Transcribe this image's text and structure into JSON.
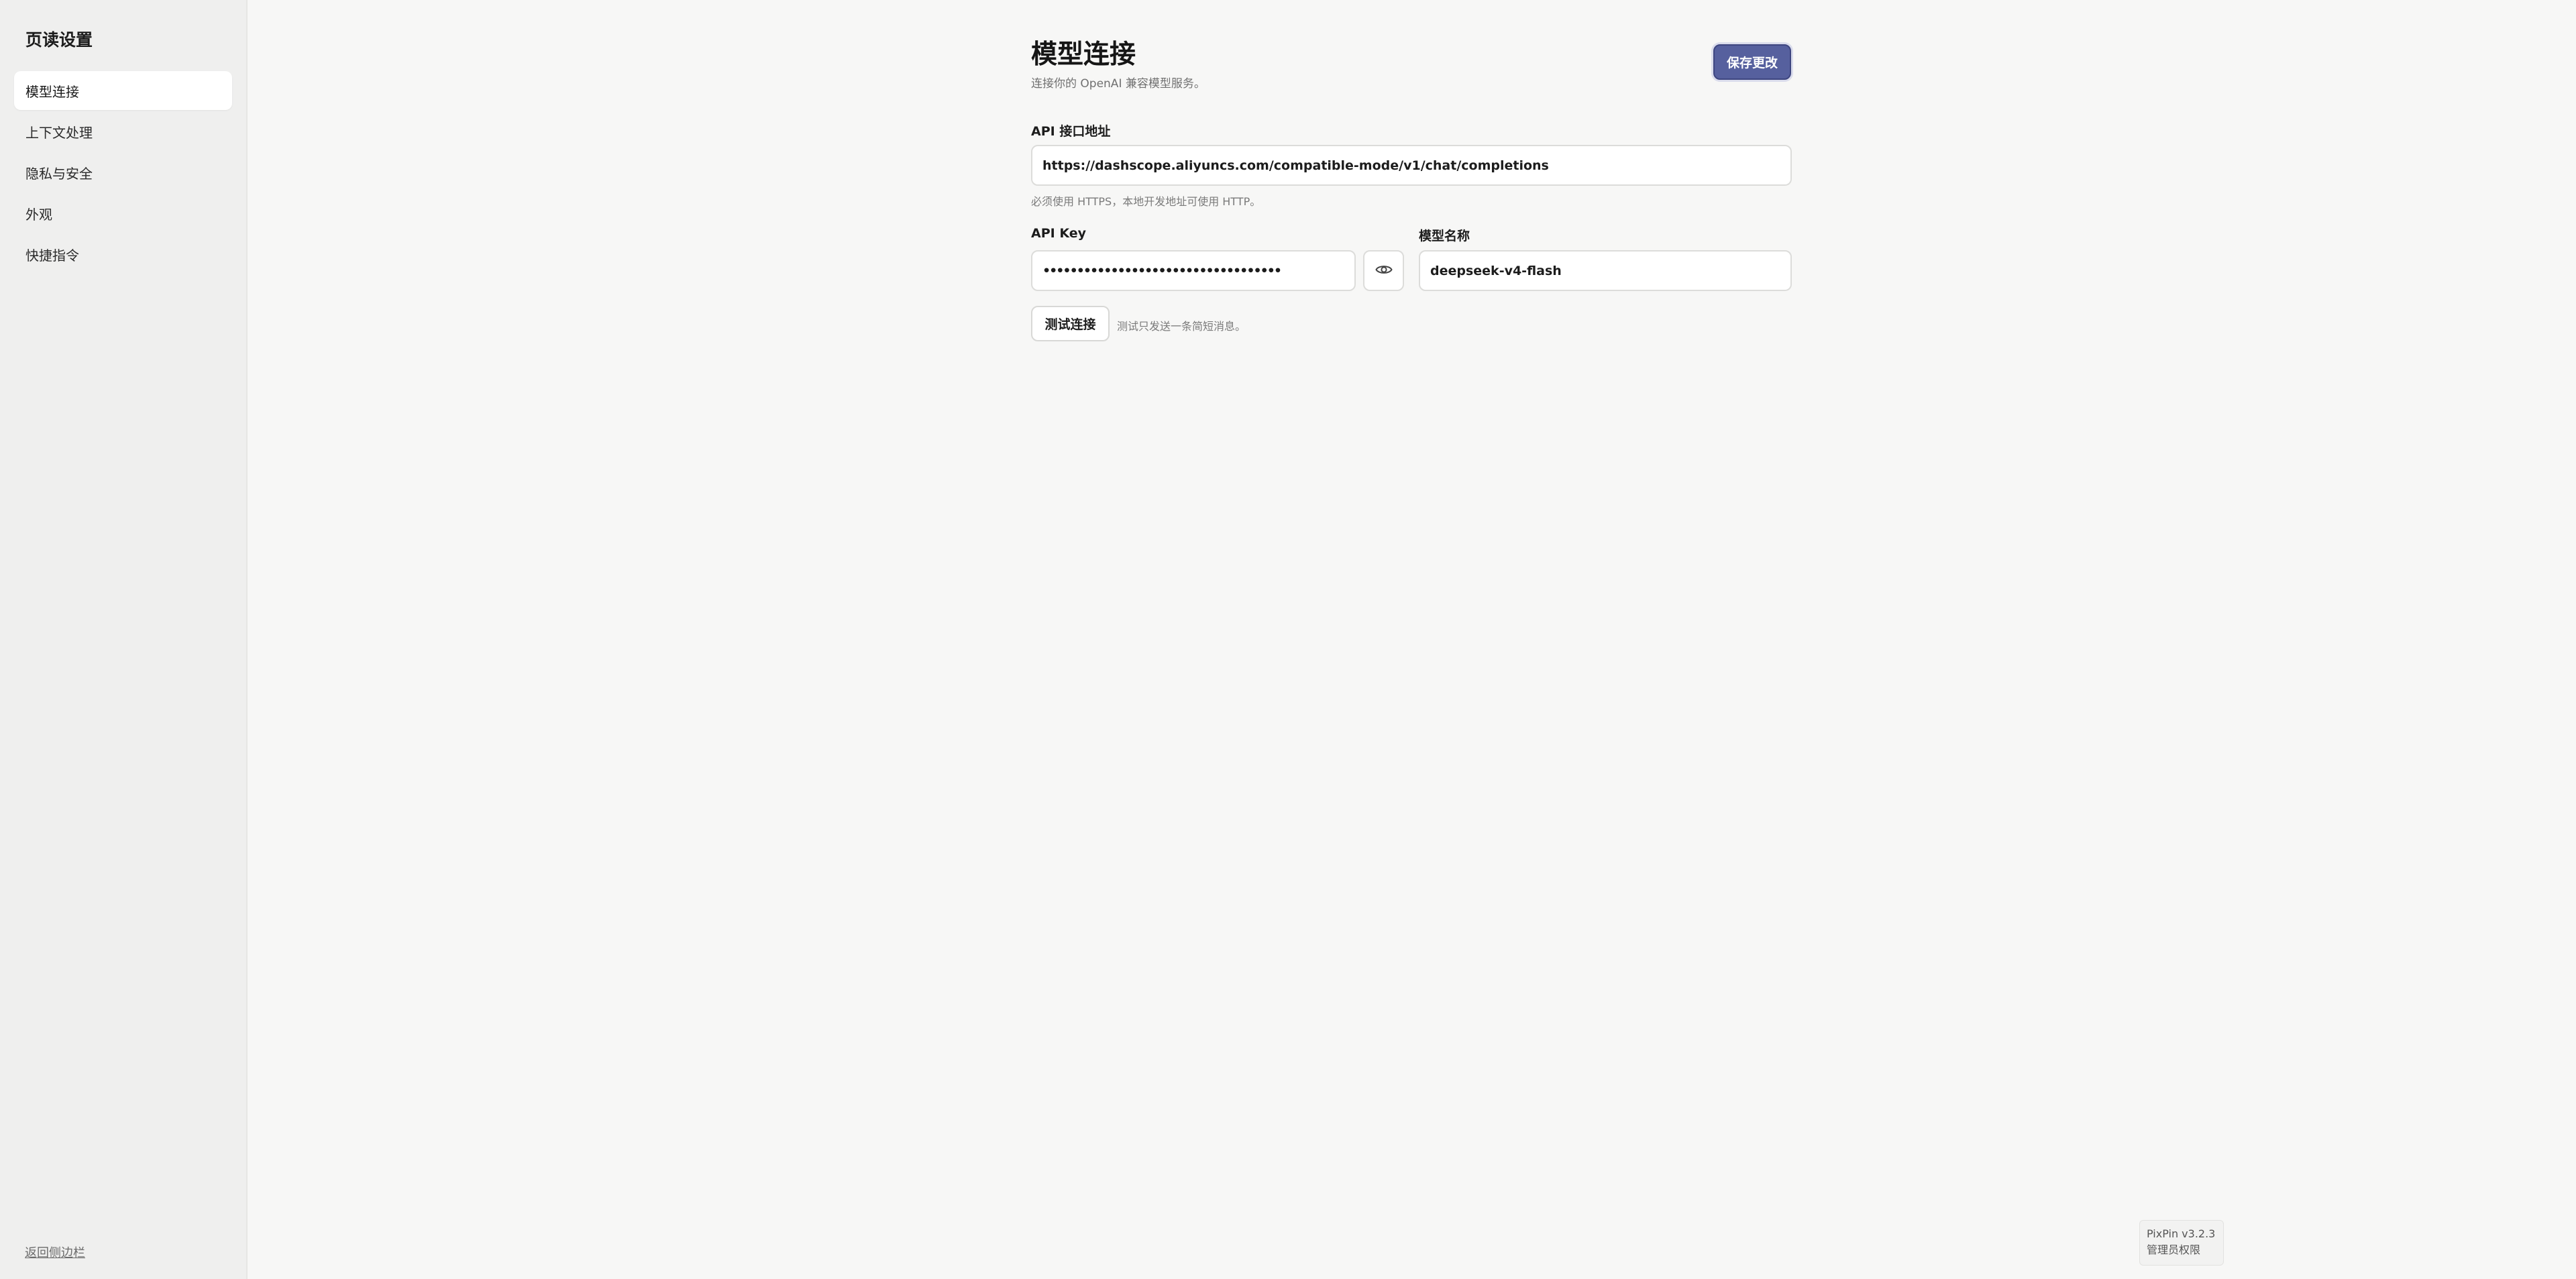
{
  "sidebar": {
    "title": "页读设置",
    "items": [
      {
        "label": "模型连接",
        "active": true
      },
      {
        "label": "上下文处理",
        "active": false
      },
      {
        "label": "隐私与安全",
        "active": false
      },
      {
        "label": "外观",
        "active": false
      },
      {
        "label": "快捷指令",
        "active": false
      }
    ],
    "footer_link": "返回侧边栏"
  },
  "header": {
    "title": "模型连接",
    "subtitle": "连接你的 OpenAI 兼容模型服务。",
    "save_label": "保存更改"
  },
  "form": {
    "endpoint": {
      "label": "API 接口地址",
      "value": "https://dashscope.aliyuncs.com/compatible-mode/v1/chat/completions",
      "hint": "必须使用 HTTPS，本地开发地址可使用 HTTP。"
    },
    "api_key": {
      "label": "API Key",
      "value": "•••••••••••••••••••••••••••••••••••",
      "toggle_icon": "eye-icon"
    },
    "model": {
      "label": "模型名称",
      "value": "deepseek-v4-flash"
    },
    "test": {
      "button_label": "测试连接",
      "hint": "测试只发送一条简短消息。"
    }
  },
  "badge": {
    "line1": "PixPin v3.2.3",
    "line2": "管理员权限"
  },
  "colors": {
    "accent": "#56609e",
    "sidebar_bg": "#efefee",
    "page_bg": "#f7f7f6"
  }
}
